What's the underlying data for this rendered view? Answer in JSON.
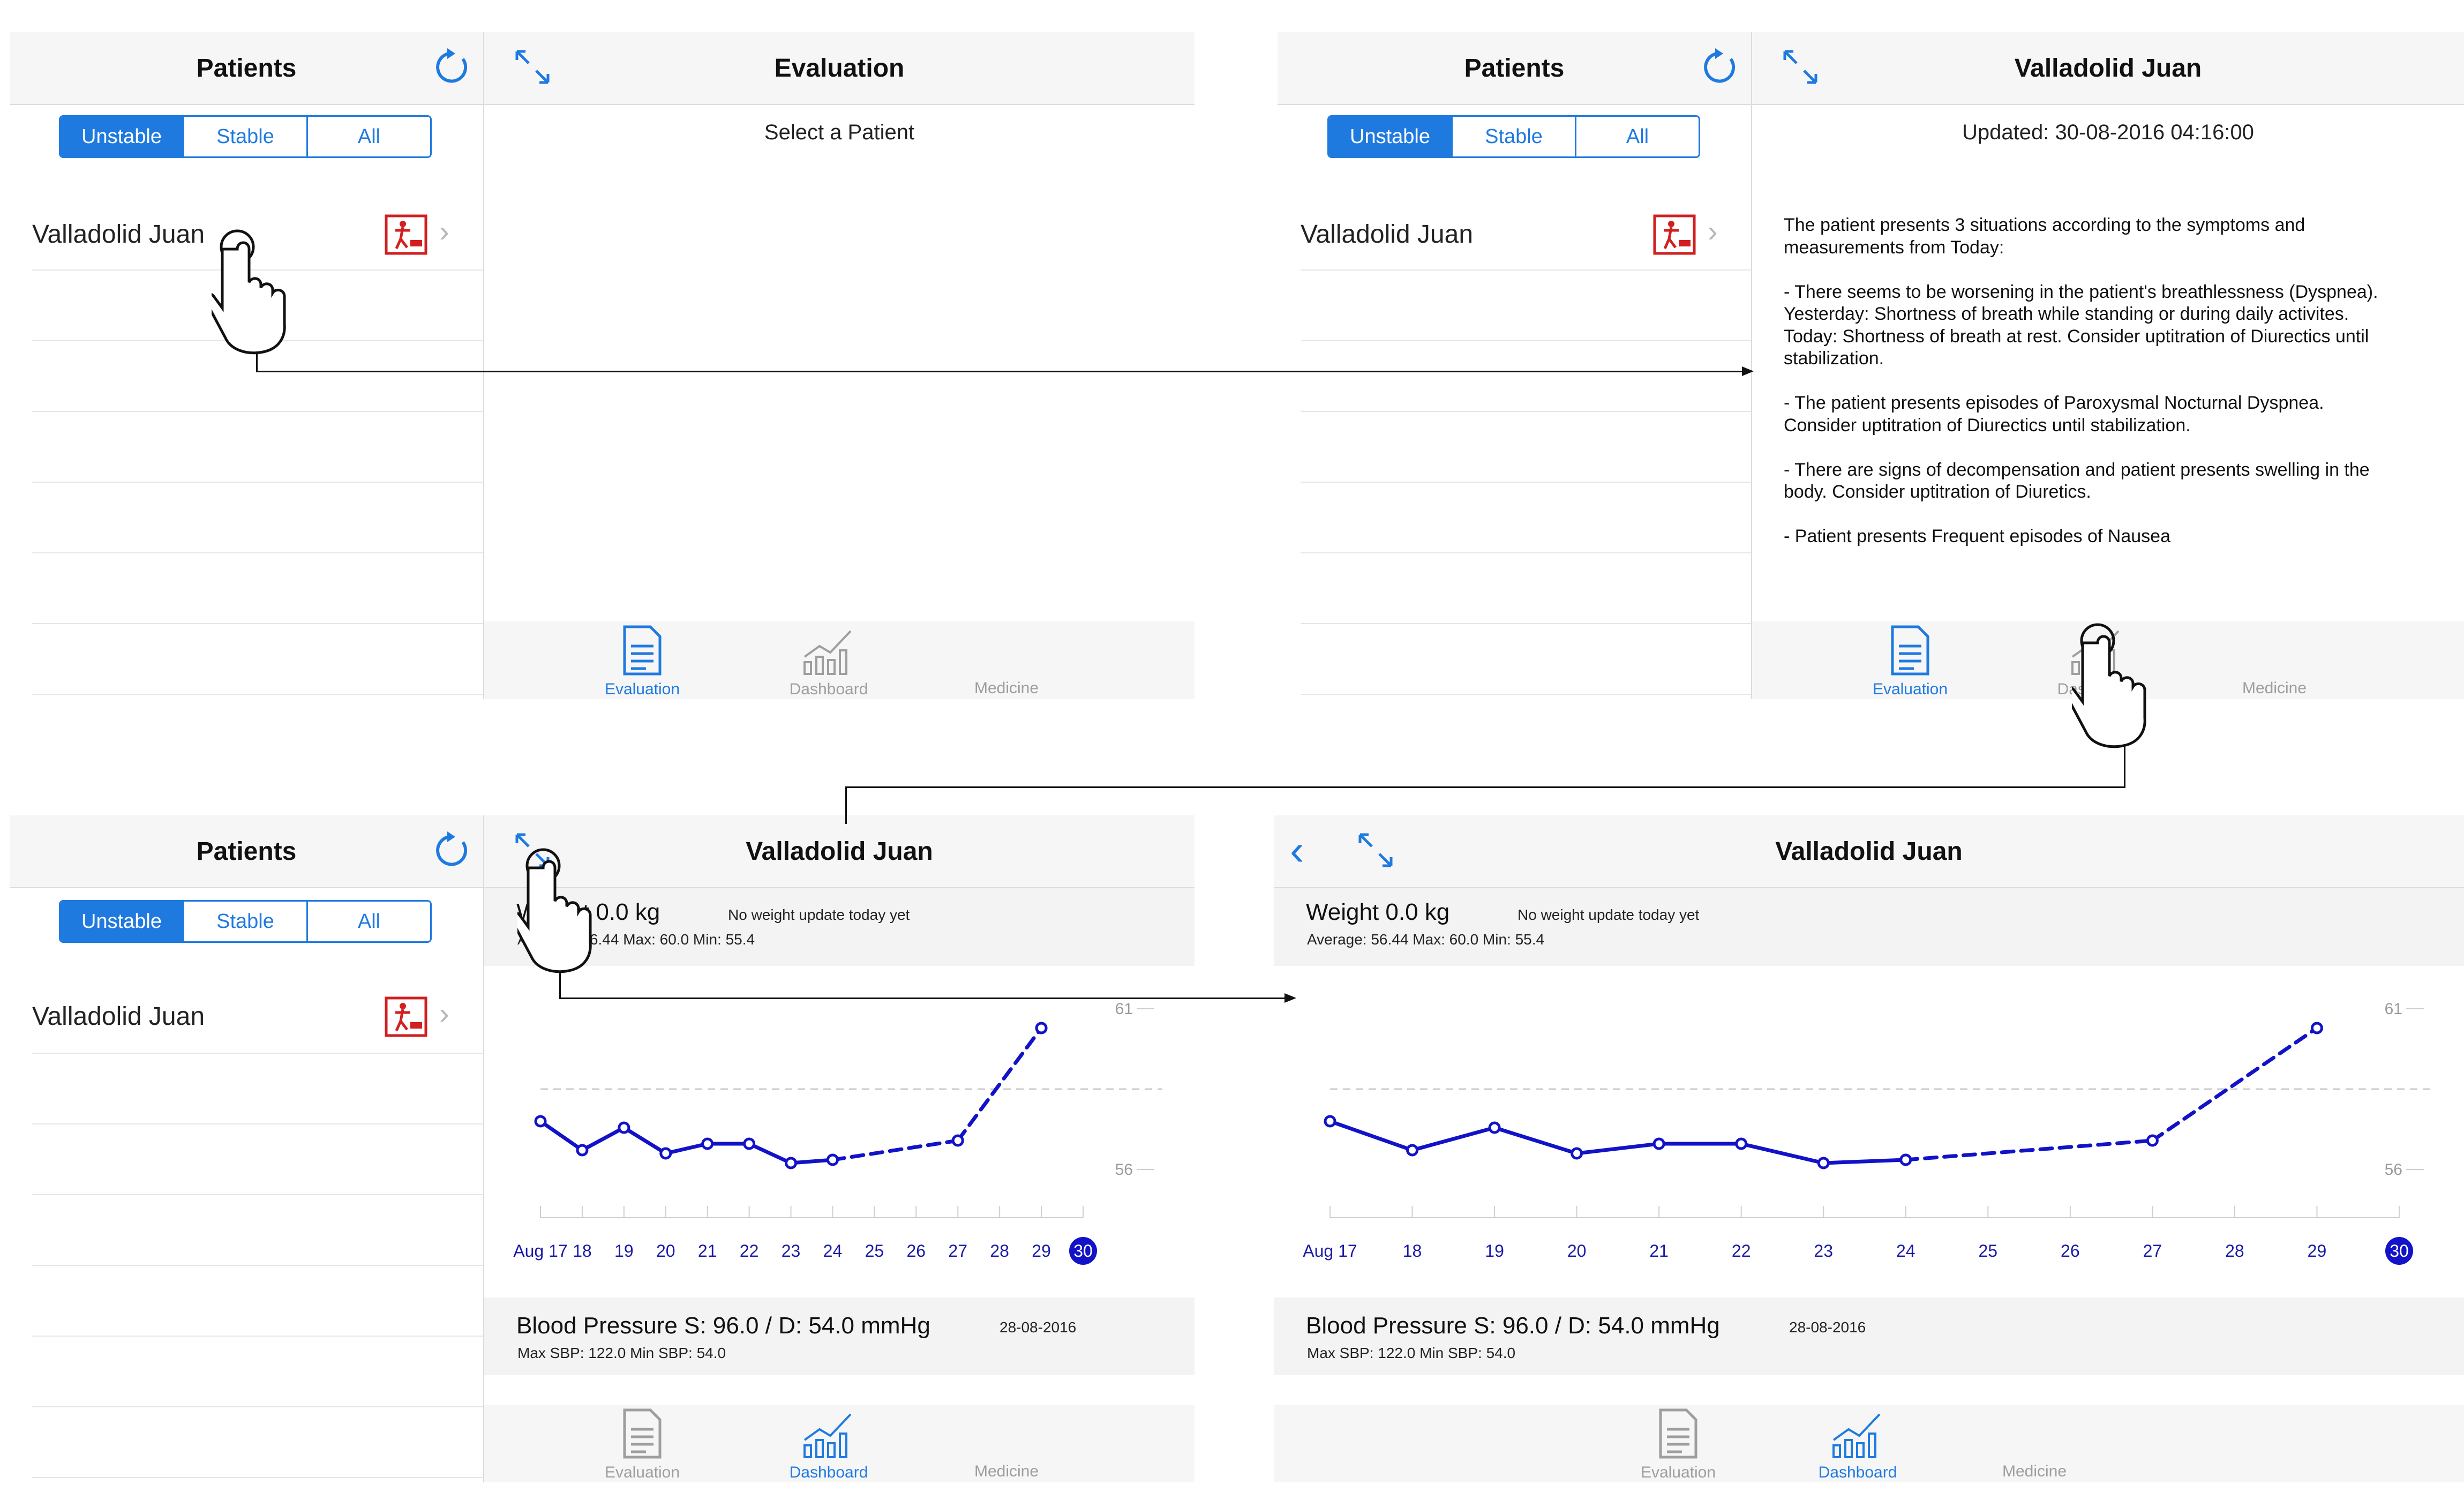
{
  "colors": {
    "accent": "#1f7ae0",
    "chart_line": "#1212c8",
    "alert_icon": "#d21f1f",
    "bar_bg": "#f6f6f7"
  },
  "patients": {
    "title": "Patients",
    "refresh_icon": "refresh-icon",
    "filters": [
      "Unstable",
      "Stable",
      "All"
    ],
    "selected_filter": "Unstable",
    "items": [
      {
        "name": "Valladolid Juan",
        "status_icon": "alert-person-icon"
      }
    ]
  },
  "evaluation_empty": {
    "title": "Evaluation",
    "placeholder": "Select a Patient"
  },
  "patient_title": "Valladolid Juan",
  "evaluation": {
    "updated": "Updated: 30-08-2016 04:16:00",
    "lines": [
      "The patient presents 3 situations according to the symptoms and",
      "measurements from Today:",
      "",
      "- There seems to be worsening in the patient's breathlessness (Dyspnea).",
      "Yesterday: Shortness of breath while standing or during daily activites.",
      "Today: Shortness of breath at rest. Consider uptitration of Diurectics until",
      "stabilization.",
      "",
      "- The patient presents episodes of Paroxysmal Nocturnal Dyspnea.",
      "Consider uptitration of Diurectics until stabilization.",
      "",
      "- There are signs of decompensation and patient presents swelling in the",
      "body. Consider uptitration of Diuretics.",
      "",
      "- Patient presents Frequent episodes of Nausea"
    ]
  },
  "tabs": [
    {
      "label": "Evaluation",
      "icon": "document-icon"
    },
    {
      "label": "Dashboard",
      "icon": "bar-chart-icon"
    },
    {
      "label": "Medicine",
      "icon": ""
    }
  ],
  "weight": {
    "title": "Weight   0.0 kg",
    "note": "No weight update today yet",
    "stats": "Average: 56.44   Max: 60.0   Min: 55.4"
  },
  "blood_pressure": {
    "title": "Blood Pressure   S: 96.0 / D: 54.0 mmHg",
    "date": "28-08-2016",
    "stats": "Max SBP: 122.0   Min SBP: 54.0"
  },
  "chart_data": {
    "type": "line",
    "title": "Weight",
    "categories": [
      "Aug 17",
      "18",
      "19",
      "20",
      "21",
      "22",
      "23",
      "24",
      "25",
      "26",
      "27",
      "28",
      "29",
      "30"
    ],
    "series": [
      {
        "values": [
          57.5,
          56.6,
          57.3,
          56.5,
          56.8,
          56.8,
          56.2,
          56.3,
          null,
          null,
          56.9,
          null,
          60.4,
          null
        ]
      }
    ],
    "y_ticks": [
      56,
      61
    ],
    "reference_line": 58.5,
    "ylim": [
      54.5,
      62
    ],
    "selected_category": "30",
    "grid": false
  }
}
